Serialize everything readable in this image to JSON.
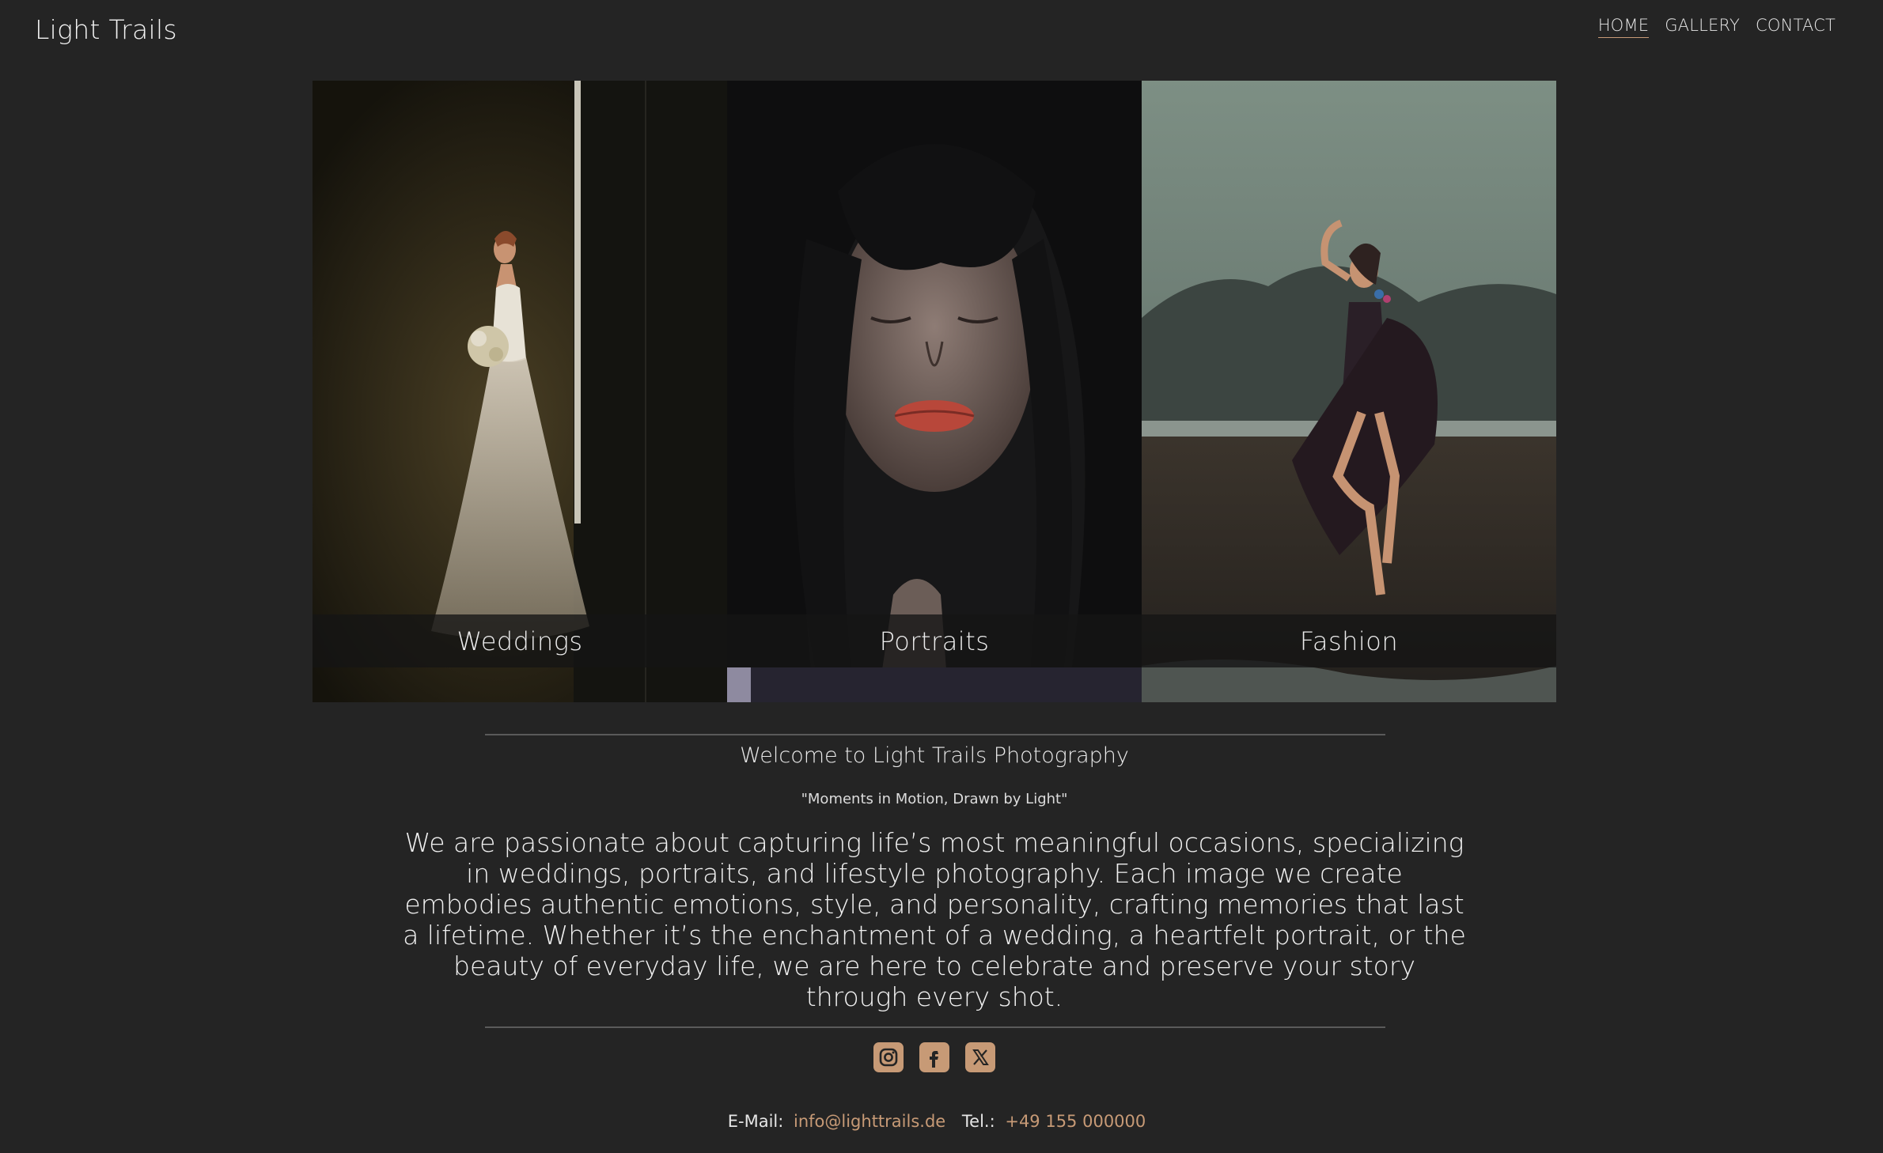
{
  "header": {
    "brand": "Light Trails",
    "nav": [
      {
        "label": "HOME",
        "active": true
      },
      {
        "label": "GALLERY",
        "active": false
      },
      {
        "label": "CONTACT",
        "active": false
      }
    ]
  },
  "categories": [
    {
      "label": "Weddings"
    },
    {
      "label": "Portraits"
    },
    {
      "label": "Fashion"
    }
  ],
  "intro": {
    "title": "Welcome to Light Trails Photography",
    "motto": "\"Moments in Motion, Drawn by Light\"",
    "body": "We are passionate about capturing life’s most meaningful occasions, specializing in weddings, portraits, and lifestyle photography. Each image we create embodies authentic emotions, style, and personality, crafting memories that last a lifetime. Whether it’s the enchantment of a wedding, a heartfelt portrait, or the beauty of everyday life, we are here to celebrate and preserve your story through every shot."
  },
  "social": [
    {
      "icon": "instagram-icon"
    },
    {
      "icon": "facebook-icon"
    },
    {
      "icon": "x-icon"
    }
  ],
  "contact": {
    "email_label": "E-Mail:",
    "email": "info@lighttrails.de",
    "tel_label": "Tel.:",
    "tel": "+49 155 000000"
  },
  "colors": {
    "background": "#242424",
    "accent": "#c79a76",
    "text": "#e8e8e8"
  }
}
